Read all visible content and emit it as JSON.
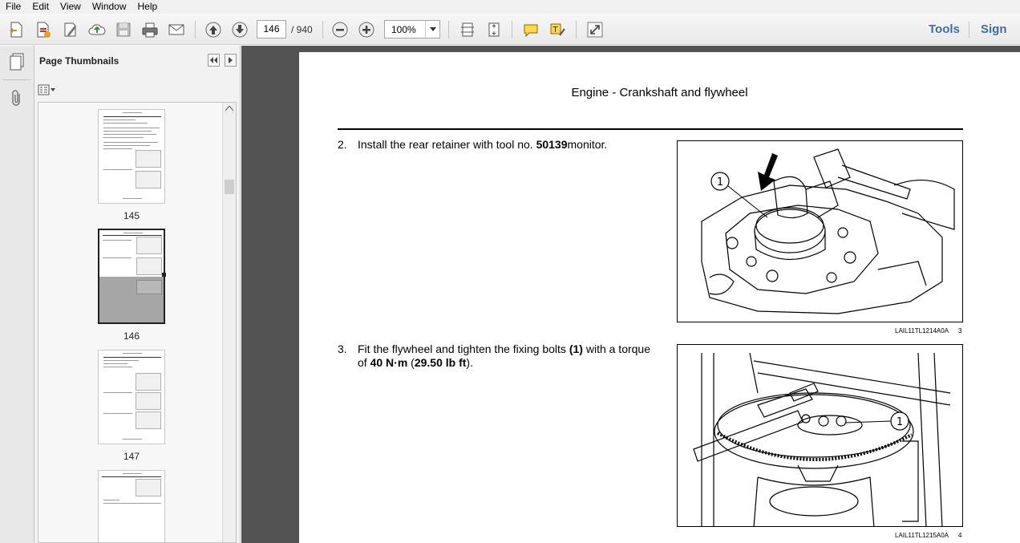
{
  "menu": [
    "File",
    "Edit",
    "View",
    "Window",
    "Help"
  ],
  "toolbar": {
    "page_current": "146",
    "page_total": "/ 940",
    "zoom": "100%",
    "tools_label": "Tools",
    "sign_label": "Sign"
  },
  "panel": {
    "title": "Page Thumbnails",
    "thumbnails": [
      {
        "label": "145"
      },
      {
        "label": "146"
      },
      {
        "label": "147"
      }
    ]
  },
  "document": {
    "header": "Engine - Crankshaft and flywheel",
    "step2": {
      "number": "2.",
      "text_before": "Install the rear retainer with tool no. ",
      "tool_no": "50139",
      "text_after": "monitor."
    },
    "step3": {
      "number": "3.",
      "text_a": "Fit the flywheel and tighten the fixing bolts ",
      "bolt_ref": "(1)",
      "text_b": " with a torque of ",
      "torque_nm": "40 N·m",
      "text_c": " (",
      "torque_lbft": "29.50 lb ft",
      "text_d": ")."
    },
    "figure1": {
      "callout": "1",
      "caption_code": "LAIL11TL1214A0A",
      "caption_num": "3"
    },
    "figure2": {
      "callout": "1",
      "caption_code": "LAIL11TL1215A0A",
      "caption_num": "4"
    }
  },
  "colors": {
    "accent_link": "#3b6ea5",
    "doc_background": "#535353",
    "toolbar": "#f0f0f0"
  }
}
